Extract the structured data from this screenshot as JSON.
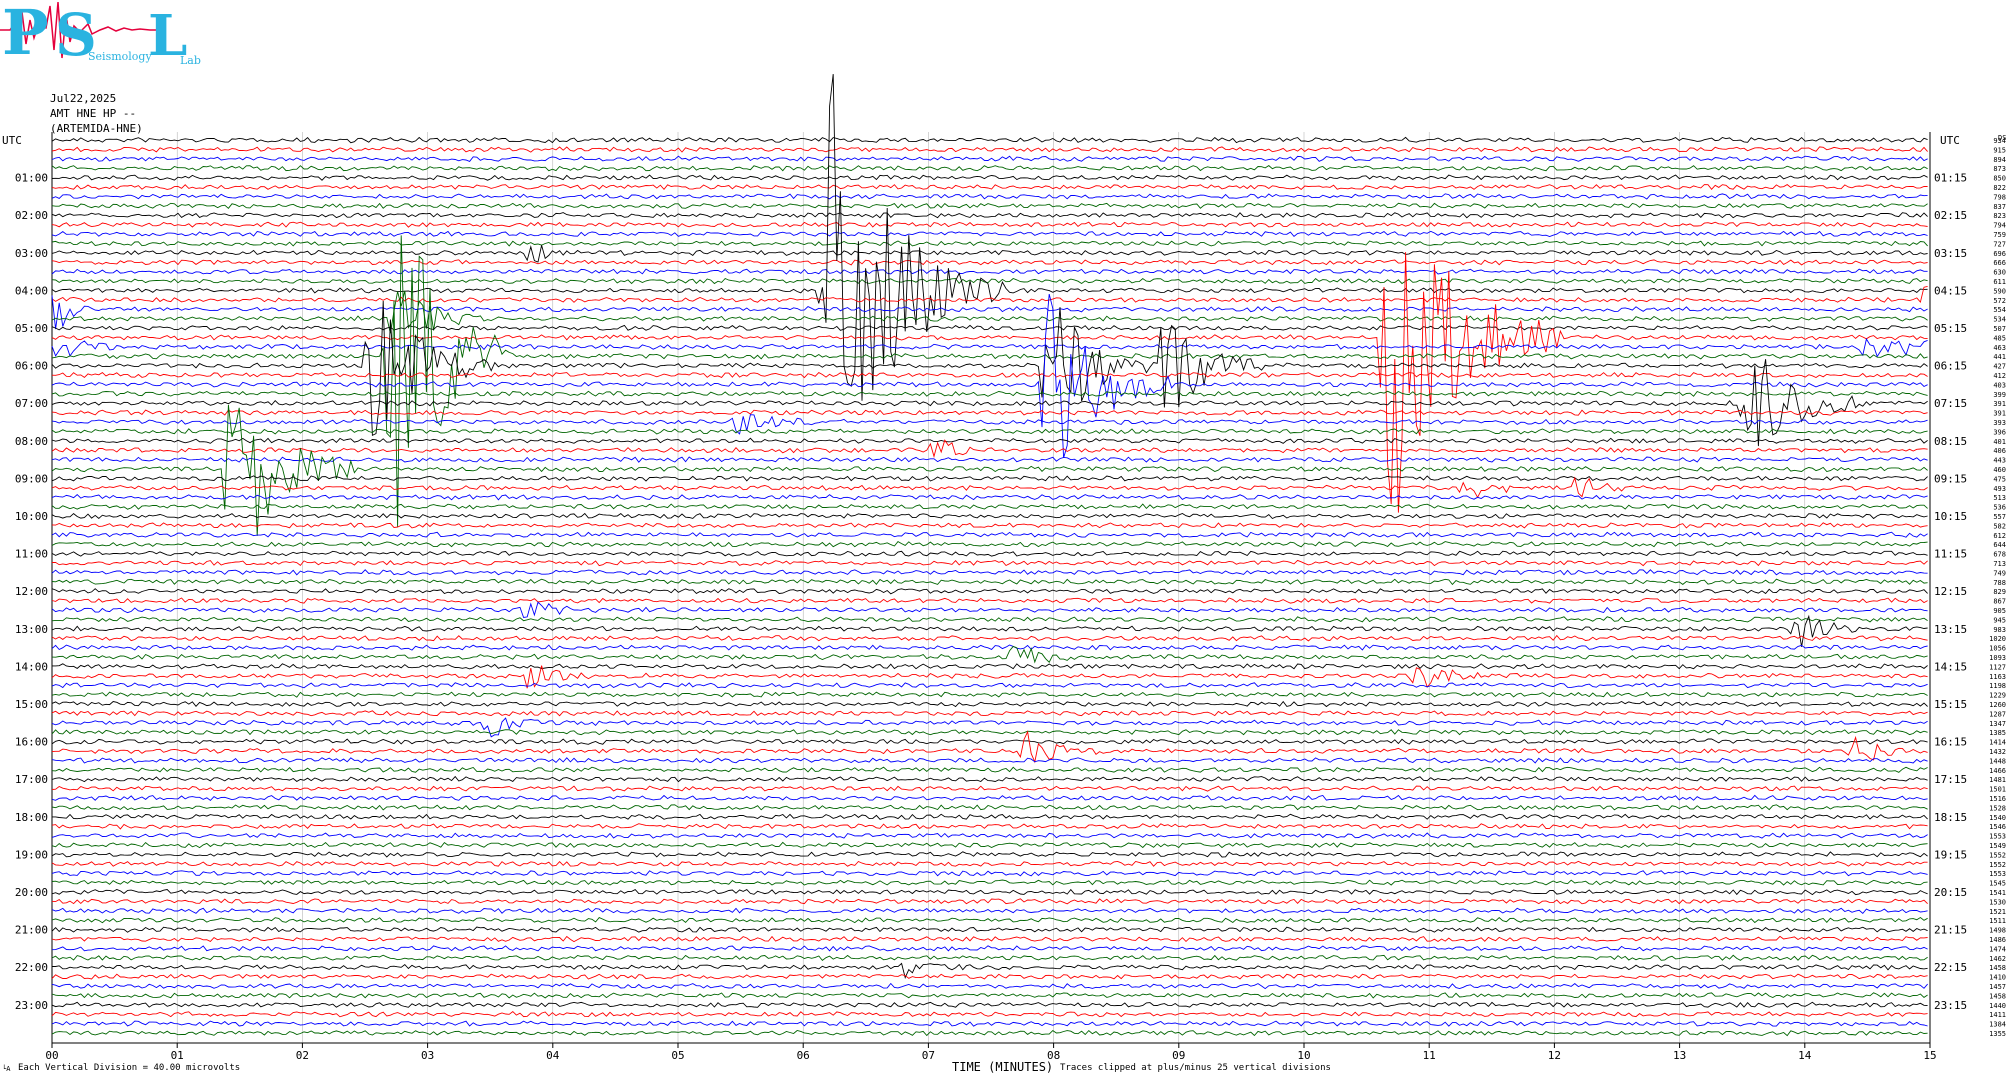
{
  "header": {
    "logo_letters": [
      "P",
      "S",
      "L"
    ],
    "logo_words": [
      "Seismology",
      "Lab"
    ],
    "date": "Jul22,2025",
    "station": "AMT HNE HP --",
    "site": "(ARTEMIDA-HNE)"
  },
  "footer": {
    "vertical_division": "Each Vertical Division =   40.00 microvolts",
    "clip_note": "Traces clipped at plus/minus 25 vertical divisions",
    "corner_mark": "└A"
  },
  "colors": {
    "trace_cycle": [
      "#000000",
      "#ff0000",
      "#0000ff",
      "#006400"
    ],
    "grid": "#aaaaaa",
    "logo": "#2ab3e0"
  },
  "chart_data": {
    "type": "line",
    "title": "",
    "xlabel": "TIME (MINUTES)",
    "ylabel": "",
    "xlim": [
      0,
      15
    ],
    "x_ticks": [
      "00",
      "01",
      "02",
      "03",
      "04",
      "05",
      "06",
      "07",
      "08",
      "09",
      "10",
      "11",
      "12",
      "13",
      "14",
      "15"
    ],
    "left_axis_label": "UTC",
    "right_axis_label": "UTC",
    "left_hour_labels": [
      "01:00",
      "02:00",
      "03:00",
      "04:00",
      "05:00",
      "06:00",
      "07:00",
      "08:00",
      "09:00",
      "10:00",
      "11:00",
      "12:00",
      "13:00",
      "14:00",
      "15:00",
      "16:00",
      "17:00",
      "18:00",
      "19:00",
      "20:00",
      "21:00",
      "22:00",
      "23:00"
    ],
    "right_hour_labels": [
      "01:15",
      "02:15",
      "03:15",
      "04:15",
      "05:15",
      "06:15",
      "07:15",
      "08:15",
      "09:15",
      "10:15",
      "11:15",
      "12:15",
      "13:15",
      "14:15",
      "15:15",
      "16:15",
      "17:15",
      "18:15",
      "19:15",
      "20:15",
      "21:15",
      "22:15",
      "23:15"
    ],
    "traces_per_hour": 4,
    "trace_count": 96,
    "right_column_header": "DS",
    "right_values": [
      "934",
      "915",
      "894",
      "873",
      "850",
      "822",
      "798",
      "837",
      "823",
      "794",
      "759",
      "727",
      "696",
      "666",
      "630",
      "611",
      "590",
      "572",
      "554",
      "534",
      "507",
      "485",
      "463",
      "441",
      "427",
      "412",
      "403",
      "399",
      "391",
      "391",
      "393",
      "396",
      "401",
      "406",
      "443",
      "460",
      "475",
      "493",
      "513",
      "536",
      "557",
      "582",
      "612",
      "644",
      "678",
      "713",
      "749",
      "788",
      "829",
      "867",
      "905",
      "945",
      "983",
      "1020",
      "1056",
      "1093",
      "1127",
      "1163",
      "1198",
      "1229",
      "1260",
      "1287",
      "1347",
      "1385",
      "1414",
      "1432",
      "1448",
      "1466",
      "1481",
      "1501",
      "1516",
      "1528",
      "1540",
      "1546",
      "1553",
      "1549",
      "1552",
      "1552",
      "1553",
      "1545",
      "1541",
      "1530",
      "1521",
      "1511",
      "1498",
      "1486",
      "1474",
      "1462",
      "1458",
      "1410",
      "1457",
      "1458",
      "1440",
      "1411",
      "1384",
      "1355"
    ],
    "events": [
      {
        "trace": 23,
        "minute": 2.72,
        "color": "red",
        "amplitude": 50,
        "duration": 1.0
      },
      {
        "trace": 19,
        "minute": 2.72,
        "color": "red",
        "amplitude": 8,
        "duration": 0.8
      },
      {
        "trace": 24,
        "minute": 2.55,
        "color": "black",
        "amplitude": 20,
        "duration": 1.0
      },
      {
        "trace": 12,
        "minute": 3.8,
        "color": "black",
        "amplitude": 4,
        "duration": 0.3
      },
      {
        "trace": 16,
        "minute": 6.2,
        "color": "black",
        "amplitude": 52,
        "duration": 1.4
      },
      {
        "trace": 35,
        "minute": 1.43,
        "color": "green",
        "amplitude": 26,
        "duration": 1.0
      },
      {
        "trace": 26,
        "minute": 7.95,
        "color": "blue",
        "amplitude": 24,
        "duration": 1.0
      },
      {
        "trace": 24,
        "minute": 7.95,
        "color": "green",
        "amplitude": 18,
        "duration": 0.9
      },
      {
        "trace": 24,
        "minute": 8.88,
        "color": "green",
        "amplitude": 14,
        "duration": 0.8
      },
      {
        "trace": 21,
        "minute": 10.67,
        "color": "black",
        "amplitude": 44,
        "duration": 1.4
      },
      {
        "trace": 28,
        "minute": 13.55,
        "color": "green",
        "amplitude": 14,
        "duration": 1.0
      },
      {
        "trace": 22,
        "minute": 14.5,
        "color": "blue",
        "amplitude": 3,
        "duration": 1.2
      },
      {
        "trace": 17,
        "minute": 15.0,
        "color": "red",
        "amplitude": 6,
        "duration": 0.6
      },
      {
        "trace": 18,
        "minute": 0.02,
        "color": "blue",
        "amplitude": 7,
        "duration": 0.3
      },
      {
        "trace": 22,
        "minute": 0.05,
        "color": "green",
        "amplitude": 3,
        "duration": 0.5
      },
      {
        "trace": 30,
        "minute": 5.5,
        "color": "green",
        "amplitude": 2.5,
        "duration": 0.6
      },
      {
        "trace": 33,
        "minute": 7.05,
        "color": "black",
        "amplitude": 3,
        "duration": 0.5
      },
      {
        "trace": 37,
        "minute": 11.3,
        "color": "green",
        "amplitude": 3,
        "duration": 0.5
      },
      {
        "trace": 37,
        "minute": 12.2,
        "color": "red",
        "amplitude": 3,
        "duration": 0.4
      },
      {
        "trace": 50,
        "minute": 3.8,
        "color": "red",
        "amplitude": 3,
        "duration": 0.4
      },
      {
        "trace": 52,
        "minute": 13.95,
        "color": "black",
        "amplitude": 4,
        "duration": 0.5
      },
      {
        "trace": 55,
        "minute": 7.7,
        "color": "blue",
        "amplitude": 3,
        "duration": 0.5
      },
      {
        "trace": 57,
        "minute": 3.8,
        "color": "blue",
        "amplitude": 4,
        "duration": 0.5
      },
      {
        "trace": 57,
        "minute": 10.9,
        "color": "blue",
        "amplitude": 4,
        "duration": 0.5
      },
      {
        "trace": 62,
        "minute": 3.5,
        "color": "blue",
        "amplitude": 3,
        "duration": 0.6
      },
      {
        "trace": 65,
        "minute": 7.8,
        "color": "black",
        "amplitude": 4,
        "duration": 0.6
      },
      {
        "trace": 65,
        "minute": 14.4,
        "color": "black",
        "amplitude": 3.5,
        "duration": 0.5
      },
      {
        "trace": 88,
        "minute": 6.8,
        "color": "red",
        "amplitude": 2,
        "duration": 0.6
      }
    ]
  }
}
